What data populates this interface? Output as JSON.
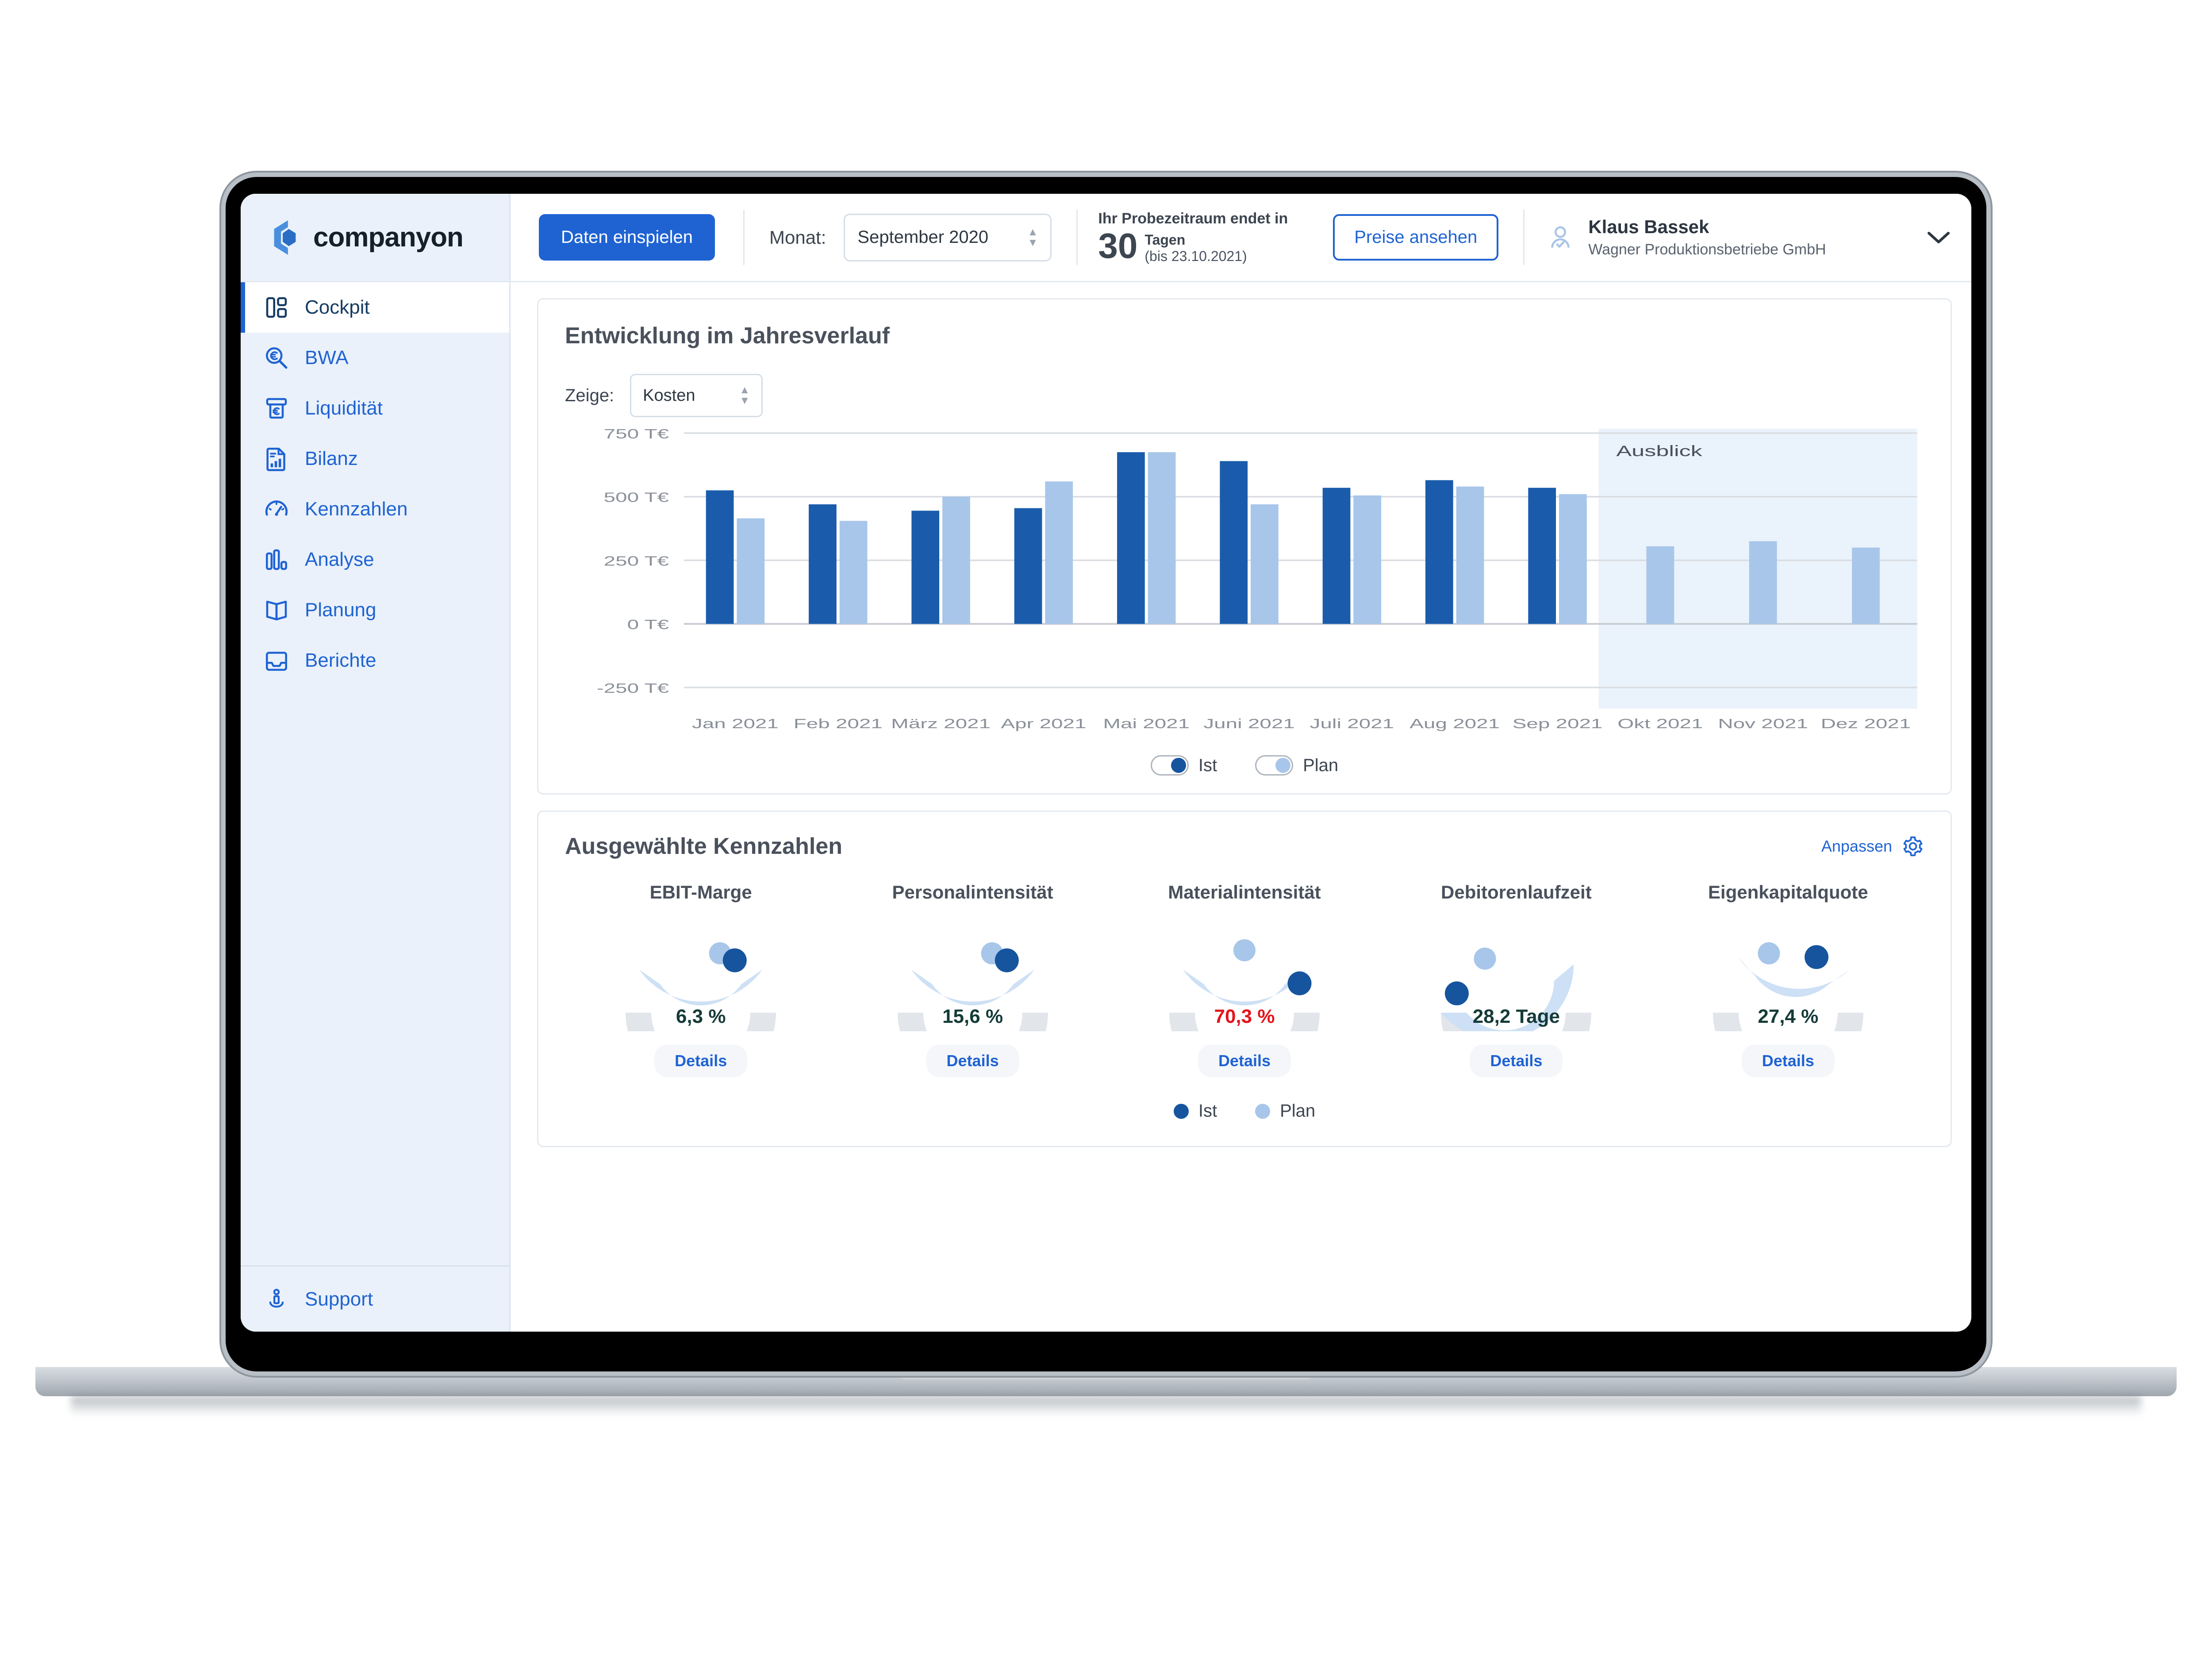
{
  "brand": {
    "name": "companyon",
    "logo_icon": "companyon-hexagon-logo"
  },
  "topbar": {
    "import_button": "Daten einspielen",
    "month_label": "Monat:",
    "month_value": "September 2020",
    "trial_prefix": "Ihr Probezeitraum endet in",
    "trial_days": "30",
    "trial_days_unit": "Tagen",
    "trial_until": "(bis 23.10.2021)",
    "pricing_button": "Preise ansehen",
    "user_name": "Klaus Bassek",
    "user_org": "Wagner Produktionsbetriebe GmbH"
  },
  "sidebar": {
    "items": [
      {
        "label": "Cockpit",
        "icon": "dashboard-grid-icon",
        "active": true
      },
      {
        "label": "BWA",
        "icon": "euro-magnifier-icon",
        "active": false
      },
      {
        "label": "Liquidität",
        "icon": "atm-euro-icon",
        "active": false
      },
      {
        "label": "Bilanz",
        "icon": "document-chart-icon",
        "active": false
      },
      {
        "label": "Kennzahlen",
        "icon": "speedometer-icon",
        "active": false
      },
      {
        "label": "Analyse",
        "icon": "bar-chart-icon",
        "active": false
      },
      {
        "label": "Planung",
        "icon": "open-book-icon",
        "active": false
      },
      {
        "label": "Berichte",
        "icon": "inbox-tray-icon",
        "active": false
      }
    ],
    "support": {
      "label": "Support",
      "icon": "support-info-icon"
    }
  },
  "chart_card": {
    "title": "Entwicklung im Jahresverlauf",
    "zeige_label": "Zeige:",
    "zeige_value": "Kosten",
    "toggles": [
      {
        "label": "Ist",
        "on": true,
        "color": "#16549e"
      },
      {
        "label": "Plan",
        "on": true,
        "color": "#a7c6ea"
      }
    ]
  },
  "chart_data": {
    "type": "bar",
    "title": "Entwicklung im Jahresverlauf",
    "xlabel": "",
    "ylabel": "",
    "unit": "T€",
    "ylim": [
      -250,
      750
    ],
    "yticks": [
      750,
      500,
      250,
      0,
      -250
    ],
    "ytick_labels": [
      "750 T€",
      "500 T€",
      "250 T€",
      "0 T€",
      "-250 T€"
    ],
    "grid": true,
    "legend_position": "bottom",
    "forecast_label": "Ausblick",
    "forecast_from": "Okt 2021",
    "categories": [
      "Jan 2021",
      "Feb 2021",
      "März 2021",
      "Apr 2021",
      "Mai 2021",
      "Juni 2021",
      "Juli 2021",
      "Aug 2021",
      "Sep 2021",
      "Okt 2021",
      "Nov 2021",
      "Dez 2021"
    ],
    "series": [
      {
        "name": "Ist",
        "color": "#1a5cab",
        "values": [
          525,
          470,
          445,
          455,
          675,
          640,
          535,
          565,
          535,
          null,
          null,
          null
        ]
      },
      {
        "name": "Plan",
        "color": "#a7c6ea",
        "values": [
          415,
          405,
          500,
          560,
          675,
          470,
          505,
          540,
          510,
          305,
          325,
          300
        ]
      }
    ]
  },
  "kpi_card": {
    "title": "Ausgewählte Kennzahlen",
    "customize_label": "Anpassen",
    "customize_icon": "gear-icon",
    "details_label": "Details",
    "legend": [
      {
        "label": "Ist",
        "color": "#16549e"
      },
      {
        "label": "Plan",
        "color": "#a7c6ea"
      }
    ],
    "kpis": [
      {
        "name": "EBIT-Marge",
        "value": "6,3 %",
        "alert": false,
        "ist_angle": 123,
        "plan_angle": 108,
        "band_start": 35,
        "band_end": 145
      },
      {
        "name": "Personalintensität",
        "value": "15,6 %",
        "alert": false,
        "ist_angle": 123,
        "plan_angle": 108,
        "band_start": 35,
        "band_end": 145
      },
      {
        "name": "Materialintensität",
        "value": "70,3 %",
        "alert": true,
        "ist_angle": 152,
        "plan_angle": 90,
        "band_start": 35,
        "band_end": 145
      },
      {
        "name": "Debitorenlaufzeit",
        "value": "28,2 Tage",
        "alert": false,
        "ist_angle": 18,
        "plan_angle": 60,
        "band_start": 0,
        "band_end": 140
      },
      {
        "name": "Eigenkapitalquote",
        "value": "27,4 %",
        "alert": false,
        "ist_angle": 117,
        "plan_angle": 72,
        "band_start": 48,
        "band_end": 145
      }
    ]
  },
  "colors": {
    "brand_blue": "#1f63d3",
    "ist": "#16549e",
    "plan": "#a7c6ea",
    "alert": "#e3141b",
    "sidebar_bg": "#eaf1fa"
  }
}
